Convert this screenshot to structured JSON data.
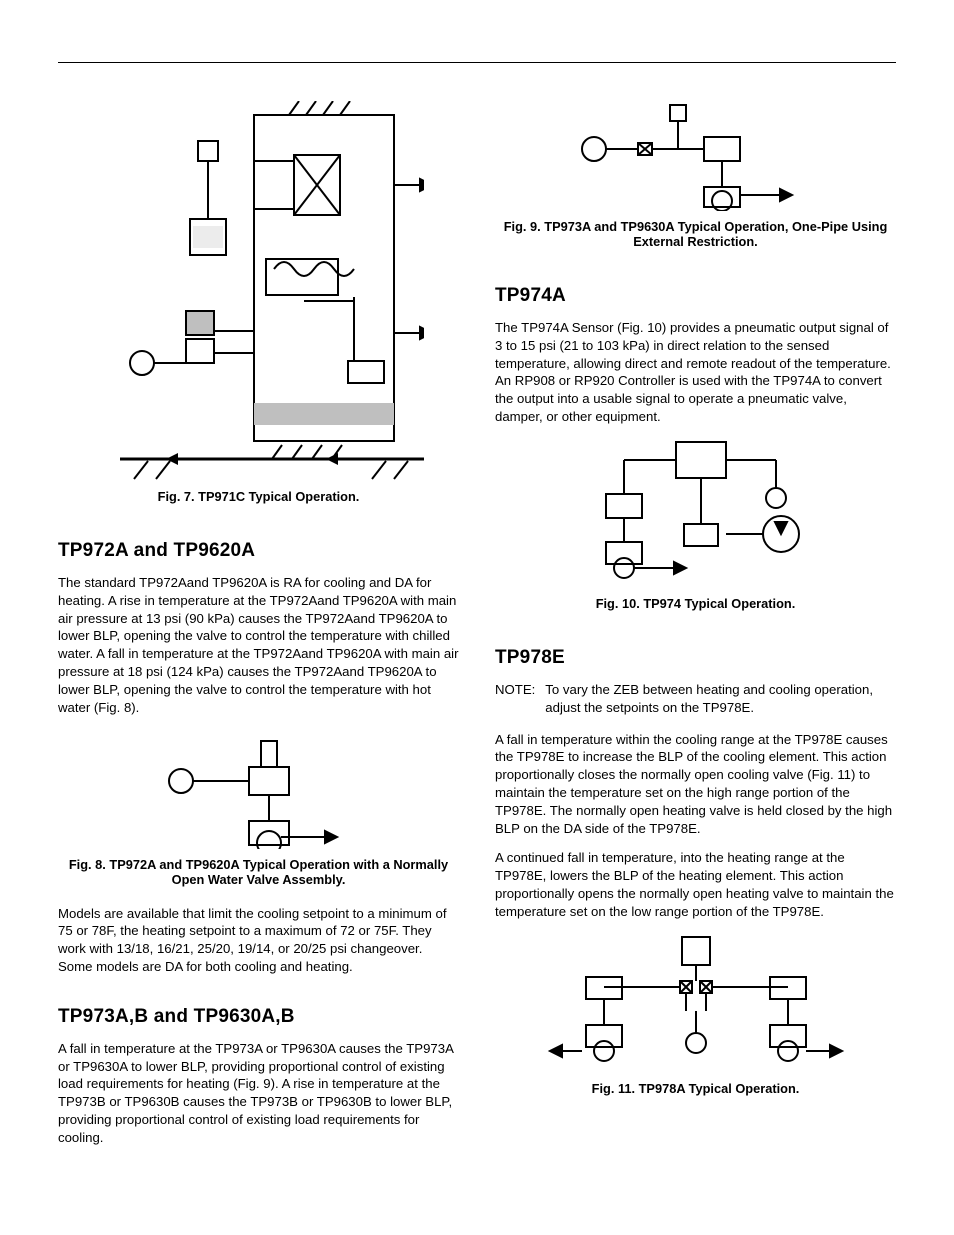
{
  "left": {
    "fig7_caption": "Fig. 7. TP971C Typical Operation.",
    "h1": "TP972A and TP9620A",
    "p1": "The standard TP972Aand TP9620A is RA for cooling and DA for heating. A rise in temperature at the TP972Aand TP9620A with main air pressure at 13 psi (90 kPa) causes the TP972Aand TP9620A to lower BLP, opening the valve to control the temperature with chilled water. A fall in temperature at the TP972Aand TP9620A with main air pressure at 18 psi (124 kPa) causes the TP972Aand TP9620A to lower BLP, opening the valve to control the temperature with hot water (Fig. 8).",
    "fig8_caption": "Fig. 8. TP972A and TP9620A Typical Operation with a Normally Open Water Valve Assembly.",
    "p2": "Models are available that limit the cooling setpoint to a minimum of 75 or 78F, the heating setpoint to a maximum of 72 or 75F. They work with 13/18, 16/21, 25/20, 19/14, or 20/25 psi changeover. Some models are DA for both cooling and heating.",
    "h2": "TP973A,B and TP9630A,B",
    "p3": "A fall in temperature at the TP973A or TP9630A causes the TP973A or TP9630A to lower BLP, providing proportional control of existing load requirements for heating (Fig. 9). A rise in temperature at the TP973B or TP9630B causes the TP973B or TP9630B to lower BLP, providing proportional control of existing load requirements for cooling."
  },
  "right": {
    "fig9_caption": "Fig. 9. TP973A and TP9630A Typical Operation, One-Pipe Using External Restriction.",
    "h1": "TP974A",
    "p1": "The TP974A Sensor (Fig. 10) provides a pneumatic output signal of 3 to 15 psi (21 to 103 kPa) in direct relation to the sensed temperature, allowing direct and remote readout of the temperature. An RP908 or RP920 Controller is used with the TP974A to convert the output into a usable signal to operate a pneumatic valve, damper, or other equipment.",
    "fig10_caption": "Fig. 10. TP974 Typical Operation.",
    "h2": "TP978E",
    "note_label": "NOTE:",
    "note_text": "To vary the ZEB between heating and cooling operation, adjust the setpoints on the TP978E.",
    "p2": "A fall in temperature within the cooling range at the TP978E causes the TP978E to increase the BLP of the cooling element. This action proportionally closes the normally open cooling valve (Fig. 11) to maintain the temperature set on the high range portion of the TP978E. The normally open heating valve is held closed by the high BLP on the DA side of the TP978E.",
    "p3": "A continued fall in temperature, into the heating range at the TP978E, lowers the BLP of the heating element. This action proportionally opens the normally open heating valve to maintain the temperature set on the low range portion of the TP978E.",
    "fig11_caption": "Fig. 11. TP978A Typical Operation."
  }
}
